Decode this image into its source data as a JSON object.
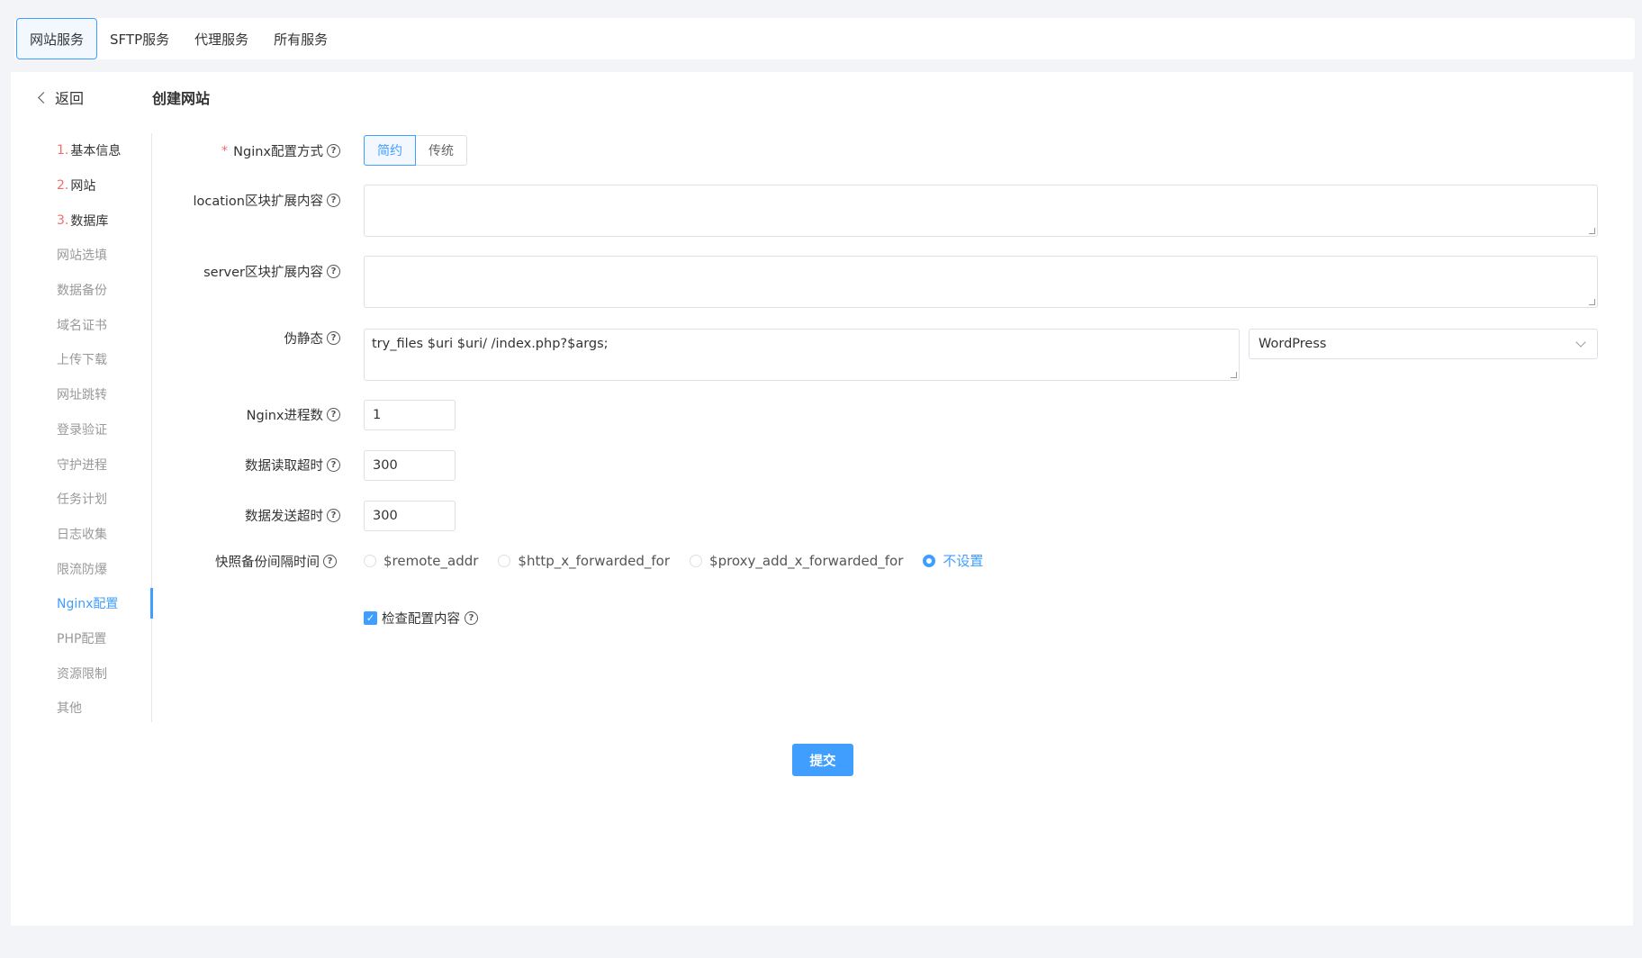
{
  "top_tabs": [
    {
      "label": "网站服务",
      "active": true
    },
    {
      "label": "SFTP服务"
    },
    {
      "label": "代理服务"
    },
    {
      "label": "所有服务"
    }
  ],
  "header": {
    "back_label": "返回",
    "title": "创建网站"
  },
  "steps": [
    {
      "num": "1.",
      "label": "基本信息",
      "status": "done"
    },
    {
      "num": "2.",
      "label": "网站",
      "status": "done"
    },
    {
      "num": "3.",
      "label": "数据库",
      "status": "done"
    },
    {
      "label": "网站选填"
    },
    {
      "label": "数据备份"
    },
    {
      "label": "域名证书"
    },
    {
      "label": "上传下载"
    },
    {
      "label": "网址跳转"
    },
    {
      "label": "登录验证"
    },
    {
      "label": "守护进程"
    },
    {
      "label": "任务计划"
    },
    {
      "label": "日志收集"
    },
    {
      "label": "限流防爆"
    },
    {
      "label": "Nginx配置",
      "status": "current"
    },
    {
      "label": "PHP配置"
    },
    {
      "label": "资源限制"
    },
    {
      "label": "其他"
    }
  ],
  "form": {
    "nginx_mode": {
      "label": "Nginx配置方式",
      "options": [
        "简约",
        "传统"
      ],
      "selected": "简约"
    },
    "location_ext": {
      "label": "location区块扩展内容",
      "value": ""
    },
    "server_ext": {
      "label": "server区块扩展内容",
      "value": ""
    },
    "rewrite": {
      "label": "伪静态",
      "value": "try_files $uri $uri/ /index.php?$args;",
      "preset": "WordPress"
    },
    "worker_processes": {
      "label": "Nginx进程数",
      "value": "1"
    },
    "read_timeout": {
      "label": "数据读取超时",
      "value": "300"
    },
    "send_timeout": {
      "label": "数据发送超时",
      "value": "300"
    },
    "snapshot_interval": {
      "label": "快照备份间隔时间",
      "options": [
        "$remote_addr",
        "$http_x_forwarded_for",
        "$proxy_add_x_forwarded_for",
        "不设置"
      ],
      "selected": "不设置"
    },
    "check_config": {
      "label": "检查配置内容",
      "checked": true
    },
    "submit_label": "提交"
  },
  "colors": {
    "accent": "#409eff",
    "required": "#f56c6c"
  }
}
